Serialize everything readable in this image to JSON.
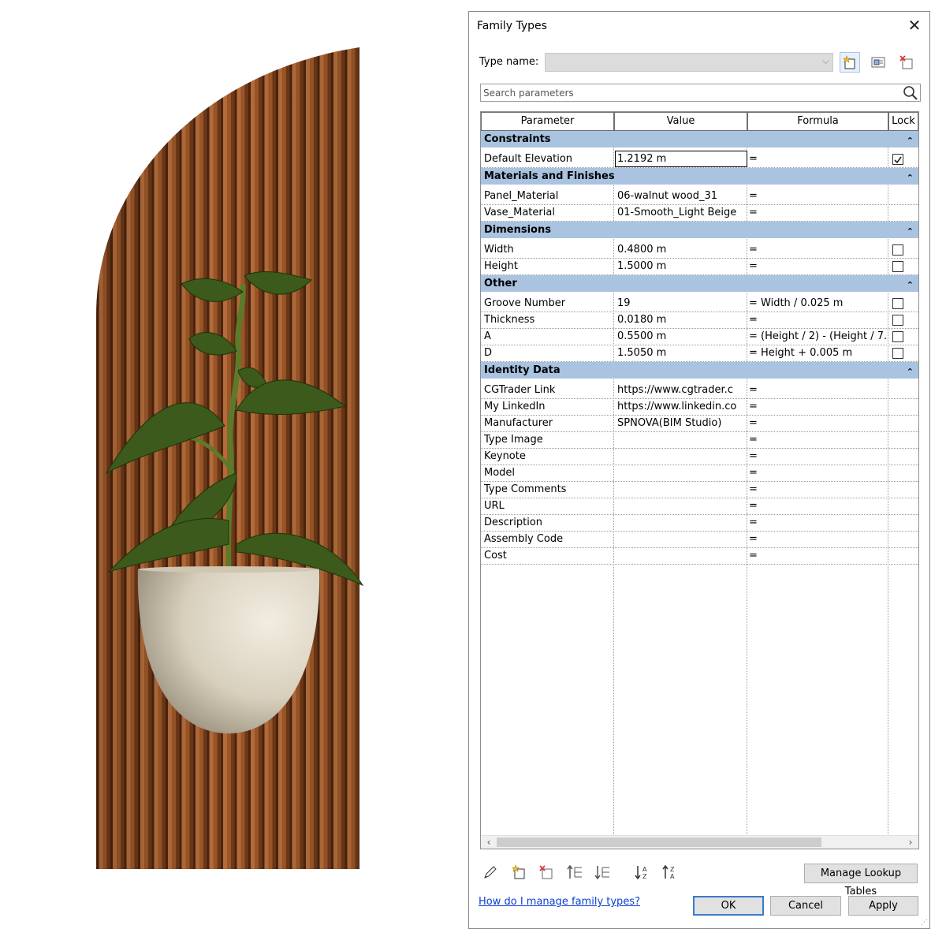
{
  "dialog": {
    "title": "Family Types",
    "type_name_label": "Type name:",
    "type_name_value": "",
    "search_placeholder": "Search parameters"
  },
  "grid": {
    "columns": [
      "Parameter",
      "Value",
      "Formula",
      "Lock"
    ],
    "groups": [
      {
        "name": "Constraints",
        "rows": [
          {
            "param": "Default Elevation",
            "value": "1.2192 m",
            "formula": "=",
            "lock": "checked",
            "active": true
          }
        ]
      },
      {
        "name": "Materials and Finishes",
        "rows": [
          {
            "param": "Panel_Material",
            "value": "06-walnut wood_31",
            "formula": "=",
            "lock": "none"
          },
          {
            "param": "Vase_Material",
            "value": "01-Smooth_Light Beige",
            "formula": "=",
            "lock": "none"
          }
        ]
      },
      {
        "name": "Dimensions",
        "rows": [
          {
            "param": "Width",
            "value": "0.4800 m",
            "formula": "=",
            "lock": "unchecked"
          },
          {
            "param": "Height",
            "value": "1.5000 m",
            "formula": "=",
            "lock": "unchecked"
          }
        ]
      },
      {
        "name": "Other",
        "rows": [
          {
            "param": "Groove Number",
            "value": "19",
            "formula": "= Width / 0.025 m",
            "lock": "unchecked"
          },
          {
            "param": "Thickness",
            "value": "0.0180 m",
            "formula": "=",
            "lock": "unchecked"
          },
          {
            "param": "A",
            "value": "0.5500 m",
            "formula": "= (Height / 2) - (Height / 7.5",
            "lock": "unchecked"
          },
          {
            "param": "D",
            "value": "1.5050 m",
            "formula": "= Height + 0.005 m",
            "lock": "unchecked"
          }
        ]
      },
      {
        "name": "Identity Data",
        "rows": [
          {
            "param": "CGTrader Link",
            "value": "https://www.cgtrader.c",
            "formula": "=",
            "lock": "none"
          },
          {
            "param": "My LinkedIn",
            "value": "https://www.linkedin.co",
            "formula": "=",
            "lock": "none"
          },
          {
            "param": "Manufacturer",
            "value": "SPNOVA(BIM Studio)",
            "formula": "=",
            "lock": "none"
          },
          {
            "param": "Type Image",
            "value": "",
            "formula": "=",
            "lock": "none"
          },
          {
            "param": "Keynote",
            "value": "",
            "formula": "=",
            "lock": "none"
          },
          {
            "param": "Model",
            "value": "",
            "formula": "=",
            "lock": "none"
          },
          {
            "param": "Type Comments",
            "value": "",
            "formula": "=",
            "lock": "none"
          },
          {
            "param": "URL",
            "value": "",
            "formula": "=",
            "lock": "none"
          },
          {
            "param": "Description",
            "value": "",
            "formula": "=",
            "lock": "none"
          },
          {
            "param": "Assembly Code",
            "value": "",
            "formula": "=",
            "lock": "none"
          },
          {
            "param": "Cost",
            "value": "",
            "formula": "=",
            "lock": "none"
          }
        ]
      }
    ]
  },
  "footer": {
    "manage_lookup": "Manage Lookup Tables",
    "help_link": "How do I manage family types?",
    "ok": "OK",
    "cancel": "Cancel",
    "apply": "Apply"
  },
  "colors": {
    "group_header": "#a9c3e0",
    "wood_dark": "#6e3a18",
    "wood_light": "#c27a45",
    "vase": "#e6dfcf",
    "leaf": "#3c5a1a",
    "link": "#0b3fd1",
    "default_button_border": "#3d7ac9"
  },
  "icons": [
    "close-icon",
    "new-type-icon",
    "rename-type-icon",
    "delete-type-icon",
    "search-icon",
    "edit-parameter-icon",
    "new-parameter-icon",
    "delete-parameter-icon",
    "move-up-icon",
    "move-down-icon",
    "sort-ascending-icon",
    "sort-descending-icon",
    "chevron-up-double-icon",
    "scroll-left-icon",
    "scroll-right-icon"
  ]
}
